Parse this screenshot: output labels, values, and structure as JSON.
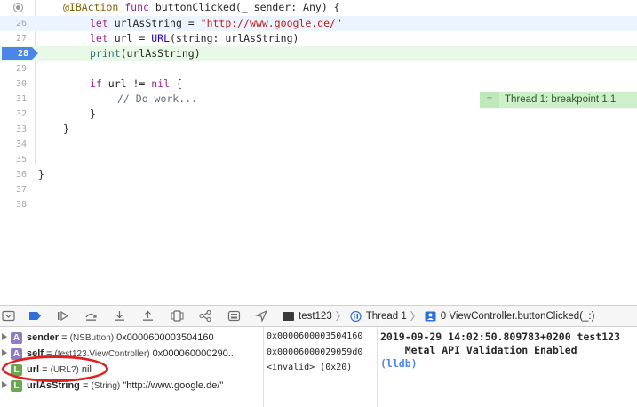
{
  "editor": {
    "lines": [
      {
        "num": "",
        "kind": "normal"
      },
      {
        "num": "26",
        "kind": "highlight"
      },
      {
        "num": "27",
        "kind": "normal"
      },
      {
        "num": "28",
        "kind": "current"
      },
      {
        "num": "29",
        "kind": "normal"
      },
      {
        "num": "30",
        "kind": "normal"
      },
      {
        "num": "31",
        "kind": "normal"
      },
      {
        "num": "32",
        "kind": "normal"
      },
      {
        "num": "33",
        "kind": "normal"
      },
      {
        "num": "34",
        "kind": "normal"
      },
      {
        "num": "35",
        "kind": "normal"
      },
      {
        "num": "36",
        "kind": "normal"
      },
      {
        "num": "37",
        "kind": "normal"
      },
      {
        "num": "38",
        "kind": "normal"
      }
    ],
    "code": {
      "l25": {
        "attr": "@IBAction",
        "kw": "func",
        "rest": " buttonClicked(_ sender: Any) {"
      },
      "l26": {
        "kw": "let",
        "rest": " urlAsString = ",
        "str": "\"http://www.google.de/\""
      },
      "l27": {
        "kw": "let",
        "rest": " url = ",
        "ty": "URL",
        "rest2": "(string: urlAsString)"
      },
      "l28": {
        "fn": "print",
        "rest": "(urlAsString)"
      },
      "l30": {
        "kw": "if",
        "rest": " url != ",
        "kw2": "nil",
        "rest2": " {"
      },
      "l31": {
        "cmt": "// Do work..."
      },
      "l32": {
        "rest": "}"
      },
      "l33": {
        "rest": "}"
      },
      "l36": {
        "rest": "}"
      }
    },
    "thread_annotation": {
      "symbol": "=",
      "text": "Thread 1: breakpoint 1.1"
    }
  },
  "debug_bar": {
    "buttons": [
      "hide-debug-area-icon",
      "breakpoints-toggle-icon",
      "continue-icon",
      "step-over-icon",
      "step-into-icon",
      "step-out-icon",
      "view-hierarchy-icon",
      "memory-graph-icon",
      "environment-overrides-icon",
      "simulate-location-icon"
    ],
    "breadcrumbs": [
      "test123",
      "Thread 1",
      "0 ViewController.buttonClicked(_:)"
    ]
  },
  "variables": [
    {
      "badge": "A",
      "name": "sender",
      "type": "(NSButton)",
      "value": "0x0000600003504160",
      "expandable": true
    },
    {
      "badge": "A",
      "name": "self",
      "type": "(test123.ViewController)",
      "value": "0x000060000290...",
      "expandable": true
    },
    {
      "badge": "L",
      "name": "url",
      "type": "(URL?)",
      "value": "nil",
      "expandable": false
    },
    {
      "badge": "L",
      "name": "urlAsString",
      "type": "(String)",
      "value": "\"http://www.google.de/\"",
      "expandable": true
    }
  ],
  "addresses": [
    "0x0000600003504160",
    "0x00006000029059d0",
    "<invalid> (0x20)"
  ],
  "console": {
    "lines": [
      "2019-09-29 14:02:50.809783+0200 test123",
      "    Metal API Validation Enabled"
    ],
    "prompt": "(lldb)"
  },
  "colors": {
    "accent": "#4a86e8",
    "annotation_red": "#e02020",
    "thread_green": "#cdefc9"
  }
}
